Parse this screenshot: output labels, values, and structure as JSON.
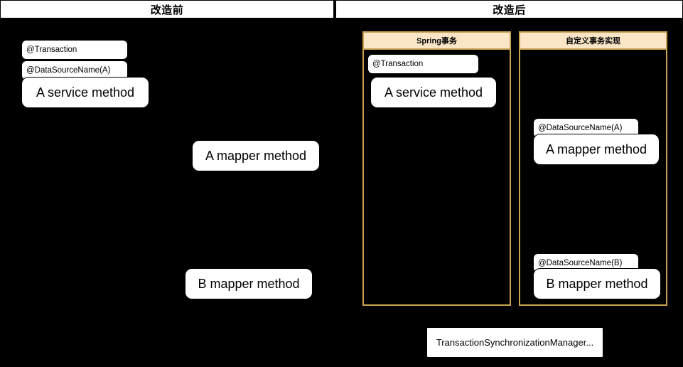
{
  "headers": {
    "before": "改造前",
    "after": "改造后"
  },
  "groups": {
    "spring": {
      "title": "Spring事务"
    },
    "custom": {
      "title": "自定义事务实现"
    }
  },
  "before_panel": {
    "annotations": {
      "transaction": "@Transaction",
      "datasource_a": "@DataSourceName(A)"
    },
    "nodes": {
      "a_service_method": "A service method",
      "a_mapper_method": "A mapper method",
      "b_mapper_method": "B mapper method"
    }
  },
  "after_panel": {
    "spring_group": {
      "annotations": {
        "transaction": "@Transaction"
      },
      "nodes": {
        "a_service_method": "A service method"
      }
    },
    "custom_group": {
      "annotations": {
        "datasource_a": "@DataSourceName(A)",
        "datasource_b": "@DataSourceName(B)"
      },
      "nodes": {
        "a_mapper_method": "A mapper method",
        "b_mapper_method": "B mapper method"
      }
    }
  },
  "footer": {
    "note": "TransactionSynchronizationManager..."
  },
  "colors": {
    "background": "#000000",
    "node_fill": "#ffffff",
    "node_border": "#000000",
    "group_border": "#c8a253",
    "group_title_fill": "#fae5c7",
    "header_fill": "#ffffff",
    "text": "#000000"
  }
}
